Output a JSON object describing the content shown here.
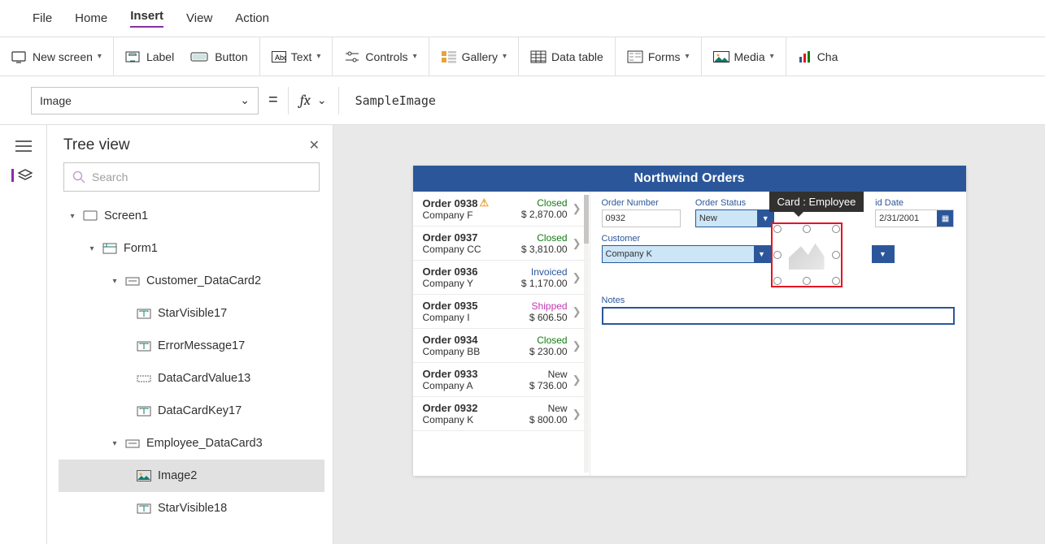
{
  "menu": {
    "file": "File",
    "home": "Home",
    "insert": "Insert",
    "view": "View",
    "action": "Action"
  },
  "toolbar": {
    "new_screen": "New screen",
    "label": "Label",
    "button": "Button",
    "text": "Text",
    "controls": "Controls",
    "gallery": "Gallery",
    "data_table": "Data table",
    "forms": "Forms",
    "media": "Media",
    "charts": "Cha"
  },
  "formula": {
    "property": "Image",
    "value": "SampleImage"
  },
  "panel": {
    "title": "Tree view",
    "search_placeholder": "Search"
  },
  "tree": {
    "screen1": "Screen1",
    "form1": "Form1",
    "customer_card": "Customer_DataCard2",
    "starvisible17": "StarVisible17",
    "errormessage17": "ErrorMessage17",
    "datacardvalue13": "DataCardValue13",
    "datacardkey17": "DataCardKey17",
    "employee_card": "Employee_DataCard3",
    "image2": "Image2",
    "starvisible18": "StarVisible18"
  },
  "app": {
    "title": "Northwind Orders",
    "tooltip": "Card : Employee",
    "orders": [
      {
        "num": "Order 0938",
        "warn": true,
        "company": "Company F",
        "status": "Closed",
        "amount": "$ 2,870.00"
      },
      {
        "num": "Order 0937",
        "warn": false,
        "company": "Company CC",
        "status": "Closed",
        "amount": "$ 3,810.00"
      },
      {
        "num": "Order 0936",
        "warn": false,
        "company": "Company Y",
        "status": "Invoiced",
        "amount": "$ 1,170.00"
      },
      {
        "num": "Order 0935",
        "warn": false,
        "company": "Company I",
        "status": "Shipped",
        "amount": "$ 606.50"
      },
      {
        "num": "Order 0934",
        "warn": false,
        "company": "Company BB",
        "status": "Closed",
        "amount": "$ 230.00"
      },
      {
        "num": "Order 0933",
        "warn": false,
        "company": "Company A",
        "status": "New",
        "amount": "$ 736.00"
      },
      {
        "num": "Order 0932",
        "warn": false,
        "company": "Company K",
        "status": "New",
        "amount": "$ 800.00"
      }
    ],
    "form": {
      "order_number_label": "Order Number",
      "order_number_value": "0932",
      "order_status_label": "Order Status",
      "order_status_value": "New",
      "paid_date_label": "id Date",
      "paid_date_value": "2/31/2001",
      "customer_label": "Customer",
      "customer_value": "Company K",
      "notes_label": "Notes"
    }
  }
}
